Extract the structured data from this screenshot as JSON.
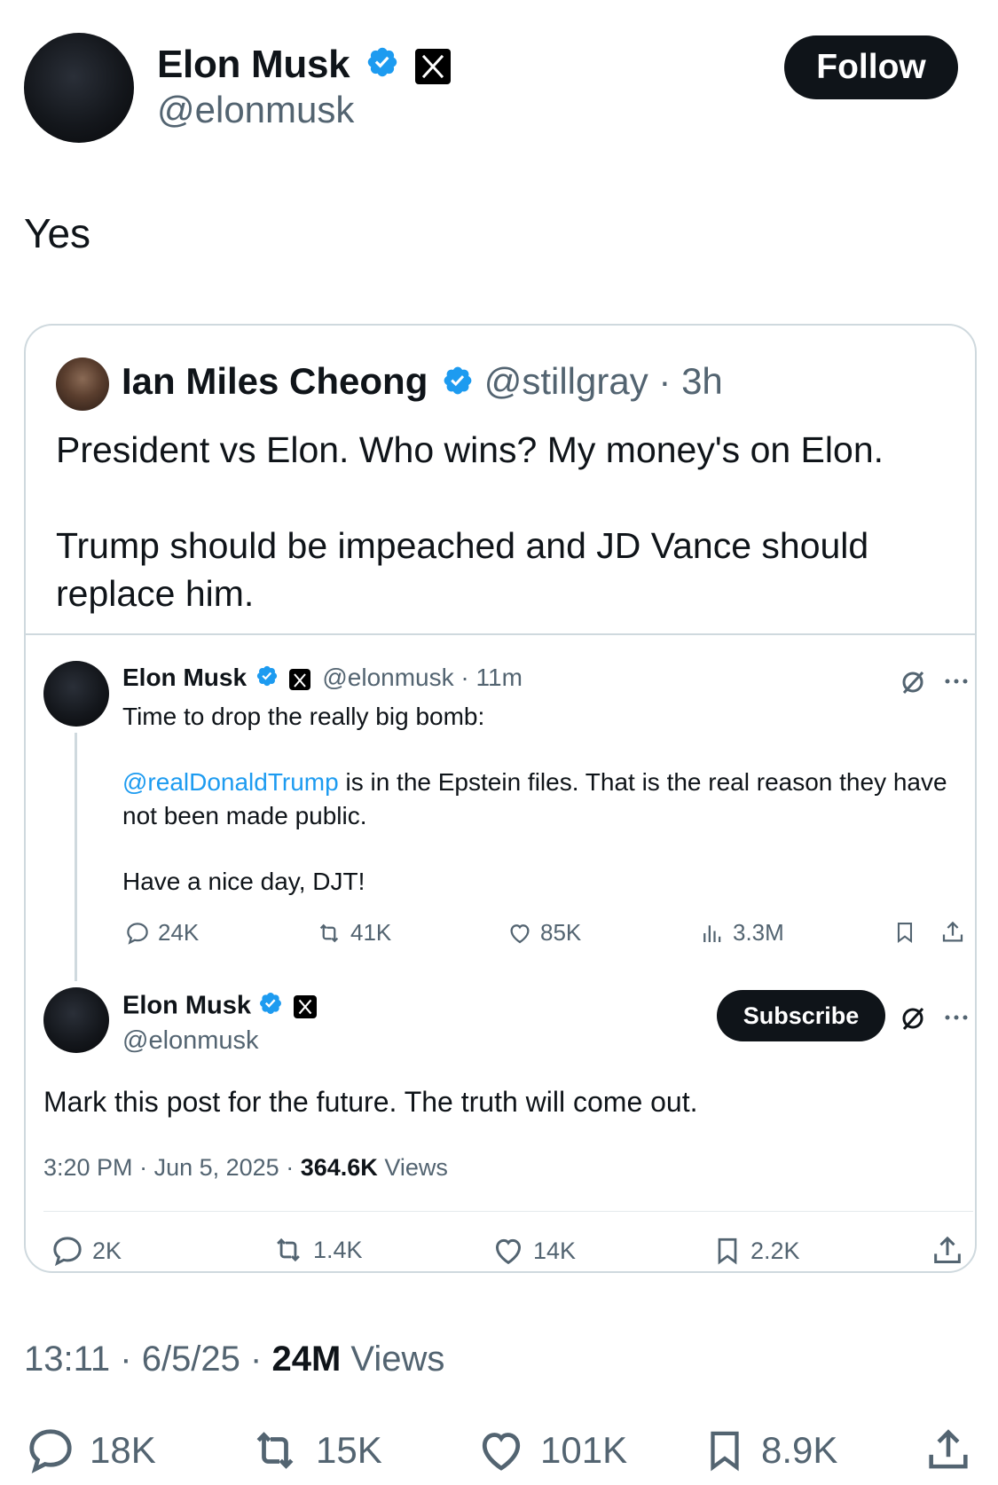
{
  "author": {
    "name": "Elon Musk",
    "handle": "@elonmusk",
    "follow_label": "Follow"
  },
  "post": {
    "text": "Yes",
    "time": "13:11",
    "date": "6/5/25",
    "views_count": "24M",
    "views_label": "Views",
    "replies": "18K",
    "reposts": "15K",
    "likes": "101K",
    "bookmarks": "8.9K"
  },
  "quote": {
    "name": "Ian Miles Cheong",
    "handle": "@stillgray",
    "age": "3h",
    "text_line1": "President vs Elon. Who wins? My money's on Elon.",
    "text_line2": "Trump should be impeached and JD Vance should replace him.",
    "embedded": {
      "first": {
        "name": "Elon Musk",
        "handle": "@elonmusk",
        "age": "11m",
        "line1": "Time to drop the really big bomb:",
        "mention": "@realDonaldTrump",
        "line2_rest": " is in the Epstein files. That is the real reason they have",
        "line3": "not been made public.",
        "line4": "Have a nice day, DJT!",
        "replies": "24K",
        "reposts": "41K",
        "likes": "85K",
        "views": "3.3M"
      },
      "second": {
        "name": "Elon Musk",
        "handle": "@elonmusk",
        "subscribe_label": "Subscribe",
        "text": "Mark this post for the future. The truth will come out.",
        "time": "3:20 PM",
        "date": "Jun 5, 2025",
        "views_count": "364.6K",
        "views_label": "Views",
        "replies": "2K",
        "reposts": "1.4K",
        "likes": "14K",
        "bookmarks": "2.2K"
      }
    }
  },
  "colors": {
    "verified": "#1d9bf0",
    "text_primary": "#0f1419",
    "text_secondary": "#536471",
    "border": "#cfd9de"
  }
}
